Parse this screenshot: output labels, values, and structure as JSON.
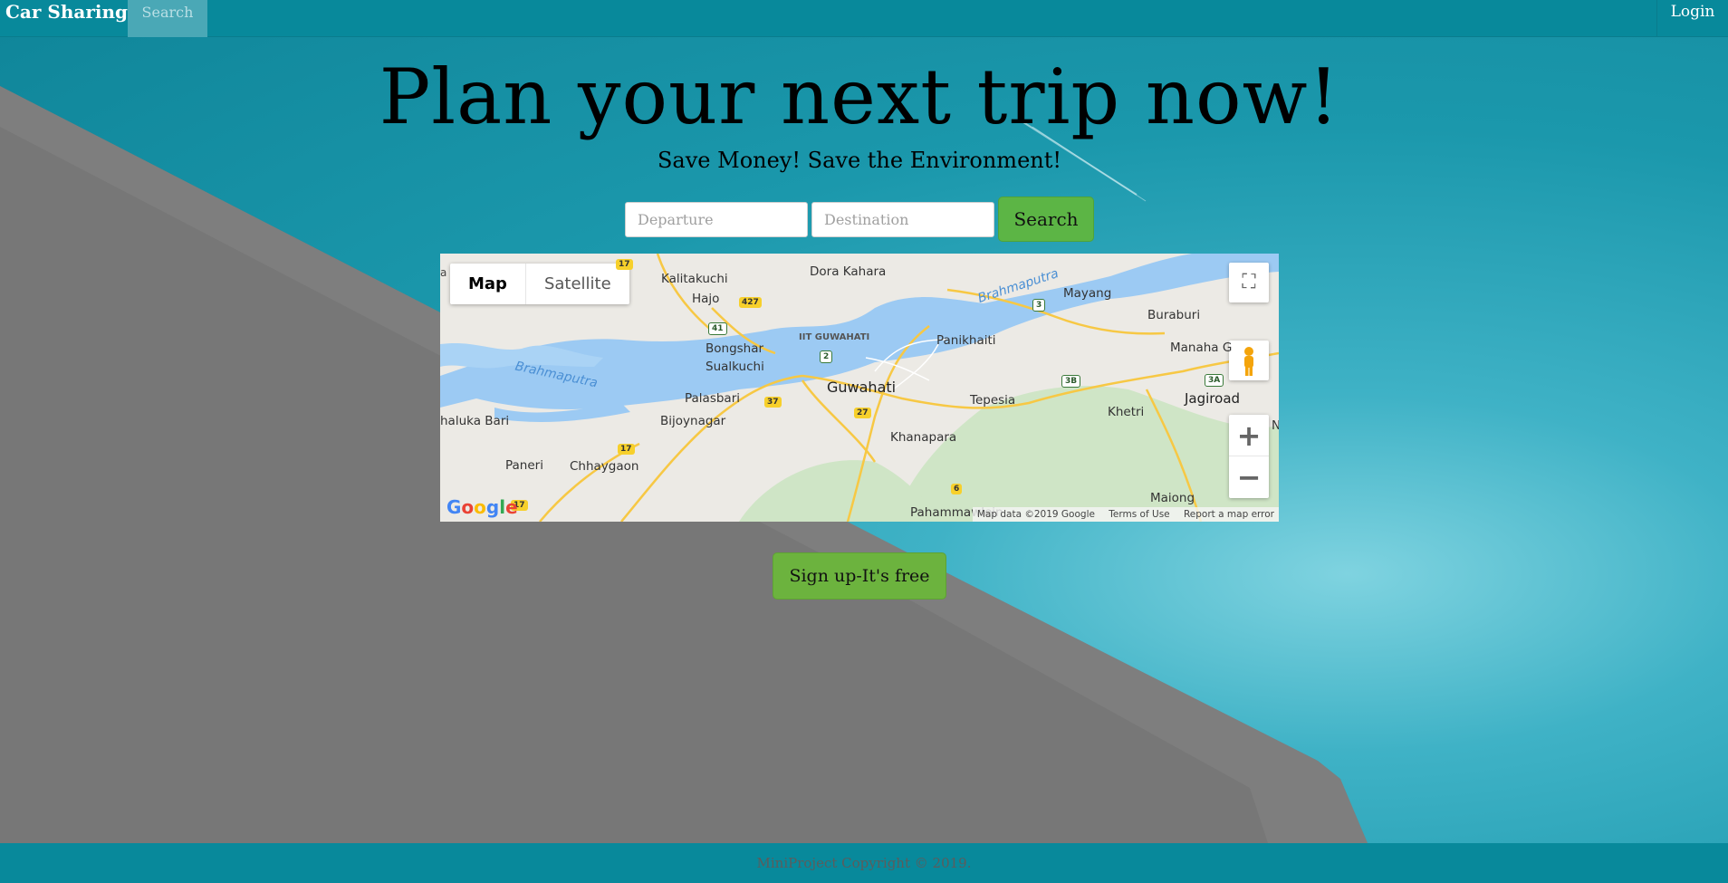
{
  "navbar": {
    "brand": "Car Sharing",
    "search_tab": "Search",
    "login": "Login"
  },
  "hero": {
    "title": "Plan your next trip now!",
    "subtitle": "Save Money! Save the Environment!"
  },
  "search": {
    "departure_placeholder": "Departure",
    "destination_placeholder": "Destination",
    "button": "Search"
  },
  "map": {
    "type_map": "Map",
    "type_satellite": "Satellite",
    "labels": {
      "dora_kahara": "Dora Kahara",
      "kalitakuchi": "Kalitakuchi",
      "hajo": "Hajo",
      "brahmaputra_ne": "Brahmaputra",
      "mayang": "Mayang",
      "buraburi": "Buraburi",
      "iit": "IIT GUWAHATI",
      "bongshar": "Bongshar",
      "sualkuchi": "Sualkuchi",
      "panikhaiti": "Panikhaiti",
      "manaha": "Manaha G",
      "brahmaputra_w": "Brahmaputra",
      "guwahati": "Guwahati",
      "palasbari": "Palasbari",
      "tepesia": "Tepesia",
      "jagiroad": "Jagiroad",
      "khaluka": "haluka Bari",
      "bijoynagar": "Bijoynagar",
      "khetri": "Khetri",
      "khanapara": "Khanapara",
      "paneri": "Paneri",
      "chhaygaon": "Chhaygaon",
      "maiong": "Maiong",
      "pahammawlein": "Pahammawlein",
      "edge_a": "a",
      "edge_n": "N"
    },
    "shields": {
      "r17a": "17",
      "r427": "427",
      "r41": "41",
      "r2": "2",
      "r3": "3",
      "r37": "37",
      "r17b": "17",
      "r27": "27",
      "r3b": "3B",
      "r3a": "3A",
      "r17c": "17",
      "r6": "6",
      "r17d": "17"
    },
    "google_logo": "Google",
    "attribution": {
      "data": "Map data ©2019 Google",
      "terms": "Terms of Use",
      "report": "Report a map error"
    },
    "zoom_in": "+",
    "zoom_out": "−",
    "fullscreen": "⛶"
  },
  "signup": {
    "button": "Sign up-It's free"
  },
  "footer": {
    "text": "MiniProject Copyright © 2019."
  }
}
